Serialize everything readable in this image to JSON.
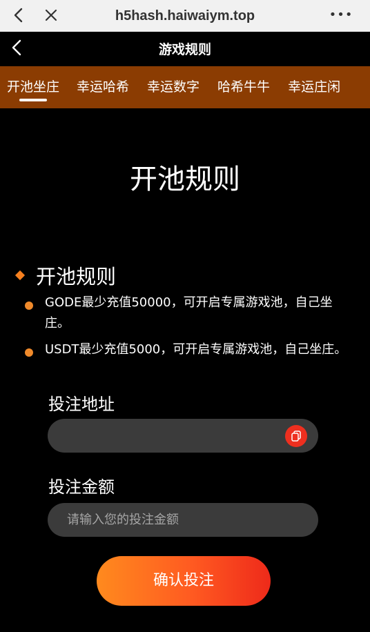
{
  "browser": {
    "url": "h5hash.haiwaiym.top",
    "more_label": "•••"
  },
  "header": {
    "title": "游戏规则"
  },
  "tabs": [
    {
      "label": "开池坐庄",
      "active": true
    },
    {
      "label": "幸运哈希",
      "active": false
    },
    {
      "label": "幸运数字",
      "active": false
    },
    {
      "label": "哈希牛牛",
      "active": false
    },
    {
      "label": "幸运庄闲",
      "active": false
    }
  ],
  "main": {
    "title": "开池规则",
    "section_heading": "开池规则",
    "rules": [
      "GODE最少充值50000，可开启专属游戏池，自己坐庄。",
      "USDT最少充值5000，可开启专属游戏池，自己坐庄。"
    ]
  },
  "form": {
    "address_label": "投注地址",
    "address_value": "",
    "amount_label": "投注金额",
    "amount_placeholder": "请输入您的投注金额",
    "confirm_label": "确认投注"
  },
  "colors": {
    "tab_bar": "#8b3c02",
    "accent_orange": "#f6801f",
    "button_start": "#ff8a1e",
    "button_end": "#ee2a1a",
    "copy_icon_bg": "#ee2f1f",
    "field_bg": "#3b3b3b"
  }
}
